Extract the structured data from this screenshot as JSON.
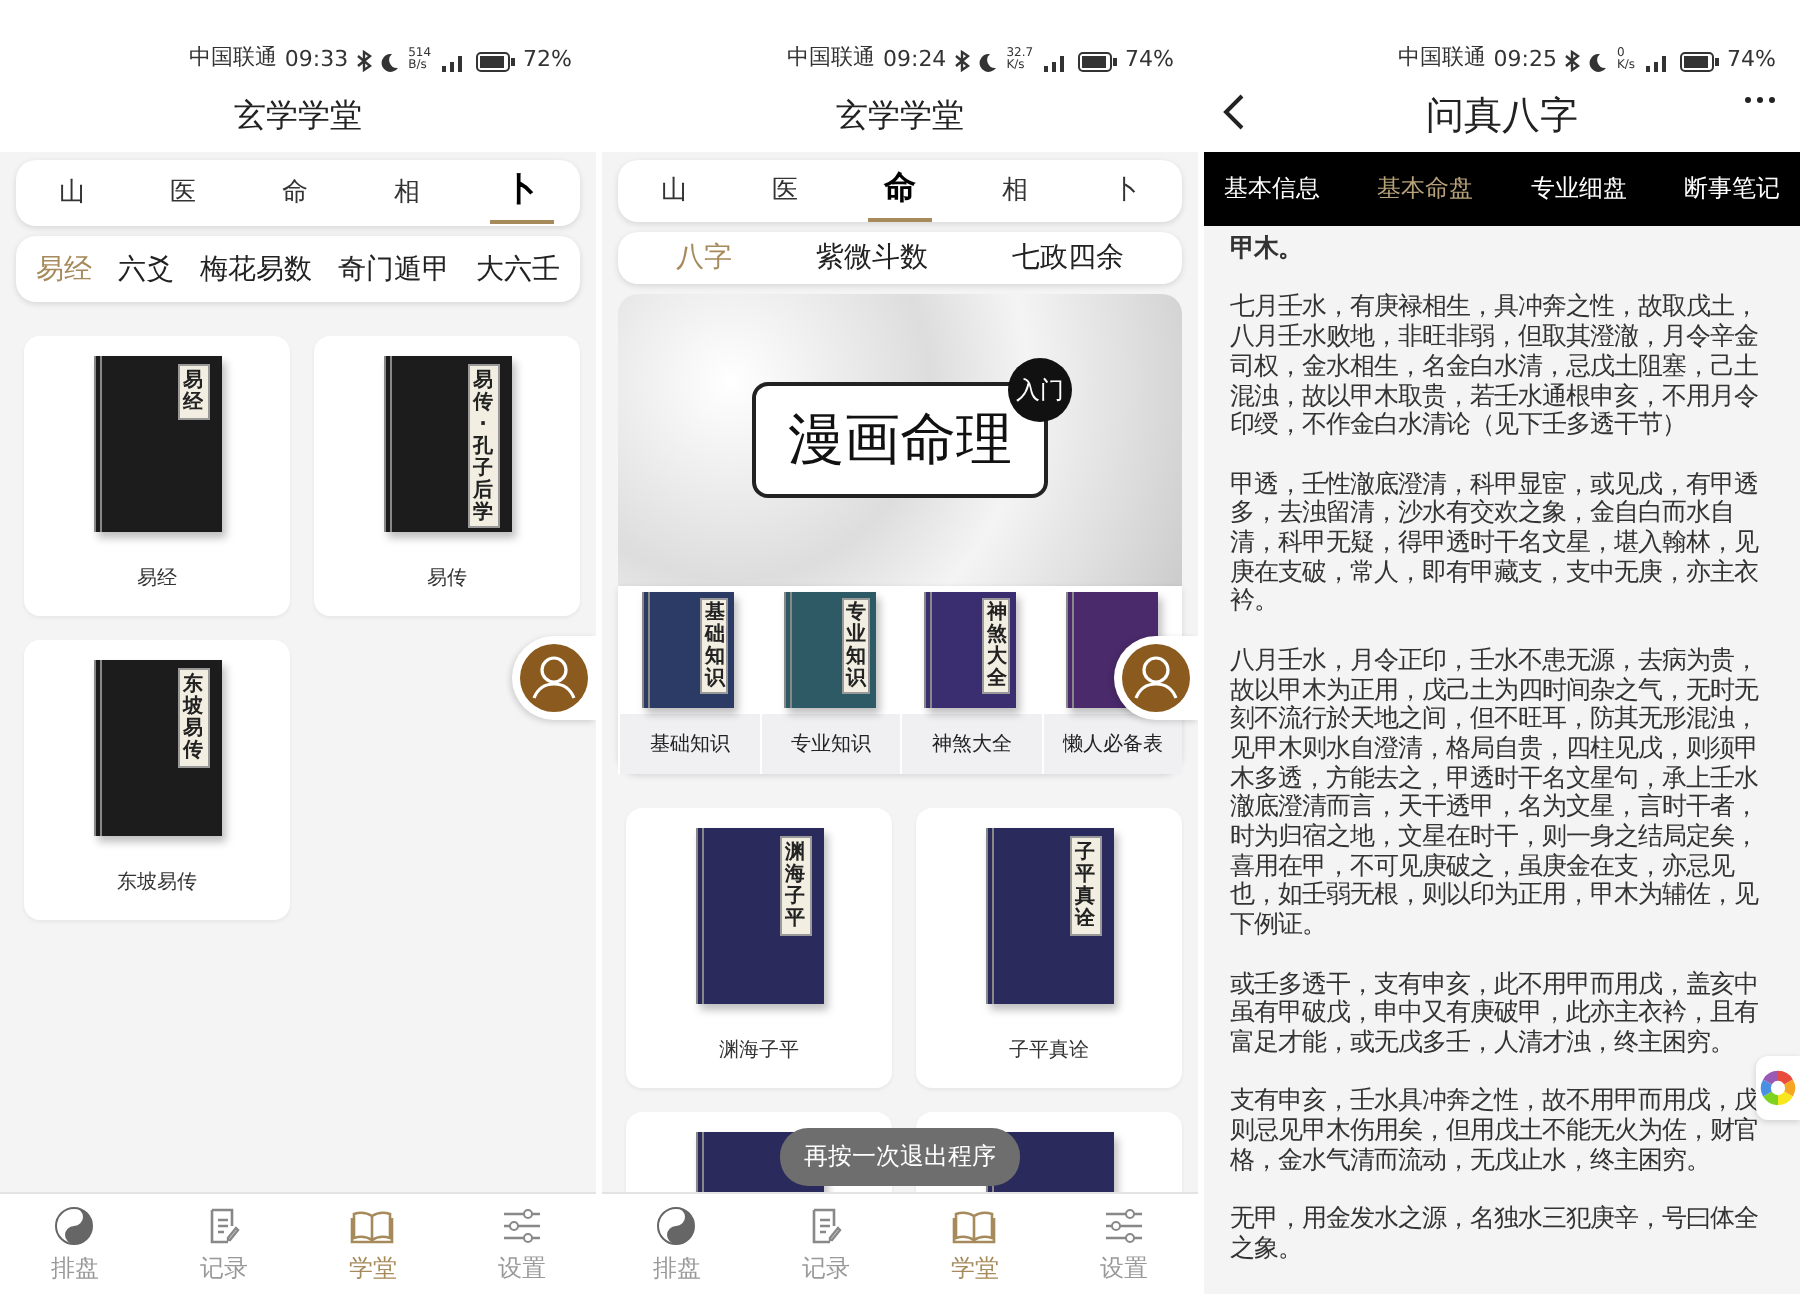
{
  "screens": [
    {
      "kind": "library",
      "status_bar": {
        "carrier": "中国联通",
        "time": "09:33",
        "speed": "514",
        "speed_unit": "B/s",
        "battery": "72%"
      },
      "title": "玄学学堂",
      "categories": [
        {
          "label": "山",
          "selected": false
        },
        {
          "label": "医",
          "selected": false
        },
        {
          "label": "命",
          "selected": false
        },
        {
          "label": "相",
          "selected": false
        },
        {
          "label": "卜",
          "selected": true
        }
      ],
      "subcategories": [
        {
          "label": "易经",
          "selected": true
        },
        {
          "label": "六爻",
          "selected": false
        },
        {
          "label": "梅花易数",
          "selected": false
        },
        {
          "label": "奇门遁甲",
          "selected": false
        },
        {
          "label": "大六壬",
          "selected": false
        }
      ],
      "books": [
        {
          "title": "易经",
          "cover_title": "易经",
          "color": "#1c1c1c"
        },
        {
          "title": "易传",
          "cover_title": "易传·孔子后学",
          "color": "#1c1c1c"
        },
        {
          "title": "东坡易传",
          "cover_title": "东坡易传",
          "color": "#1c1c1c"
        }
      ],
      "nav": [
        {
          "label": "排盘",
          "selected": false
        },
        {
          "label": "记录",
          "selected": false
        },
        {
          "label": "学堂",
          "selected": true
        },
        {
          "label": "设置",
          "selected": false
        }
      ]
    },
    {
      "kind": "library",
      "status_bar": {
        "carrier": "中国联通",
        "time": "09:24",
        "speed": "32.7",
        "speed_unit": "K/s",
        "battery": "74%"
      },
      "title": "玄学学堂",
      "categories": [
        {
          "label": "山",
          "selected": false
        },
        {
          "label": "医",
          "selected": false
        },
        {
          "label": "命",
          "selected": true
        },
        {
          "label": "相",
          "selected": false
        },
        {
          "label": "卜",
          "selected": false
        }
      ],
      "subcategories": [
        {
          "label": "八字",
          "selected": true
        },
        {
          "label": "紫微斗数",
          "selected": false
        },
        {
          "label": "七政四余",
          "selected": false
        }
      ],
      "banner": {
        "title": "漫画命理",
        "badge": "入门"
      },
      "topics": [
        {
          "label": "基础知识",
          "cover_title": "基础知识",
          "color": "#2c3a66"
        },
        {
          "label": "专业知识",
          "cover_title": "专业知识",
          "color": "#2e5a66"
        },
        {
          "label": "神煞大全",
          "cover_title": "神煞大全",
          "color": "#3a2e70"
        },
        {
          "label": "懒人必备表",
          "color": "#4a2a6a"
        }
      ],
      "books": [
        {
          "title": "渊海子平",
          "cover_title": "渊海子平",
          "color": "#2a2a5c"
        },
        {
          "title": "子平真诠",
          "cover_title": "子平真诠",
          "color": "#2a2a5c"
        },
        {
          "color": "#2a2a5c"
        },
        {
          "color": "#2a2a5c"
        }
      ],
      "toast": "再按一次退出程序",
      "nav": [
        {
          "label": "排盘",
          "selected": false
        },
        {
          "label": "记录",
          "selected": false
        },
        {
          "label": "学堂",
          "selected": true
        },
        {
          "label": "设置",
          "selected": false
        }
      ]
    },
    {
      "kind": "article",
      "status_bar": {
        "carrier": "中国联通",
        "time": "09:25",
        "speed": "0",
        "speed_unit": "K/s",
        "battery": "74%"
      },
      "title": "问真八字",
      "tabs": [
        {
          "label": "基本信息",
          "selected": false
        },
        {
          "label": "基本命盘",
          "selected": true
        },
        {
          "label": "专业细盘",
          "selected": false
        },
        {
          "label": "断事笔记",
          "selected": false
        }
      ],
      "paragraphs": [
        "甲木。",
        "七月壬水，有庚禄相生，具冲奔之性，故取戊土，八月壬水败地，非旺非弱，但取其澄澈，月令辛金司权，金水相生，名金白水清，忌戊土阻塞，己土混浊，故以甲木取贵，若壬水通根申亥，不用月令印绶，不作金白水清论（见下壬多透干节）",
        "甲透，壬性澈底澄清，科甲显宦，或见戊，有甲透多，去浊留清，沙水有交欢之象，金自白而水自清，科甲无疑，得甲透时干名文星，堪入翰林，见庚在支破，常人，即有甲藏支，支中无庚，亦主衣衿。",
        "八月壬水，月令正印，壬水不患无源，去病为贵，故以甲木为正用，戊己土为四时间杂之气，无时无刻不流行於天地之间，但不旺耳，防其无形混浊，见甲木则水自澄清，格局自贵，四柱见戊，则须甲木多透，方能去之，甲透时干名文星句，承上壬水澈底澄清而言，天干透甲，名为文星，言时干者，时为归宿之地，文星在时干，则一身之结局定矣，喜用在甲，不可见庚破之，虽庚金在支，亦忌见也，如壬弱无根，则以印为正用，甲木为辅佐，见下例证。",
        "或壬多透干，支有申亥，此不用甲而用戊，盖亥中虽有甲破戊，申中又有庚破甲，此亦主衣衿，且有富足才能，或无戊多壬，人清才浊，终主困穷。",
        "支有申亥，壬水具冲奔之性，故不用甲而用戊，戊则忌见甲木伤用矣，但用戊土不能无火为佐，财官格，金水气清而流动，无戊止水，终主困穷。",
        "无甲，用金发水之源，名独水三犯庚辛，号曰体全之象。"
      ]
    }
  ]
}
